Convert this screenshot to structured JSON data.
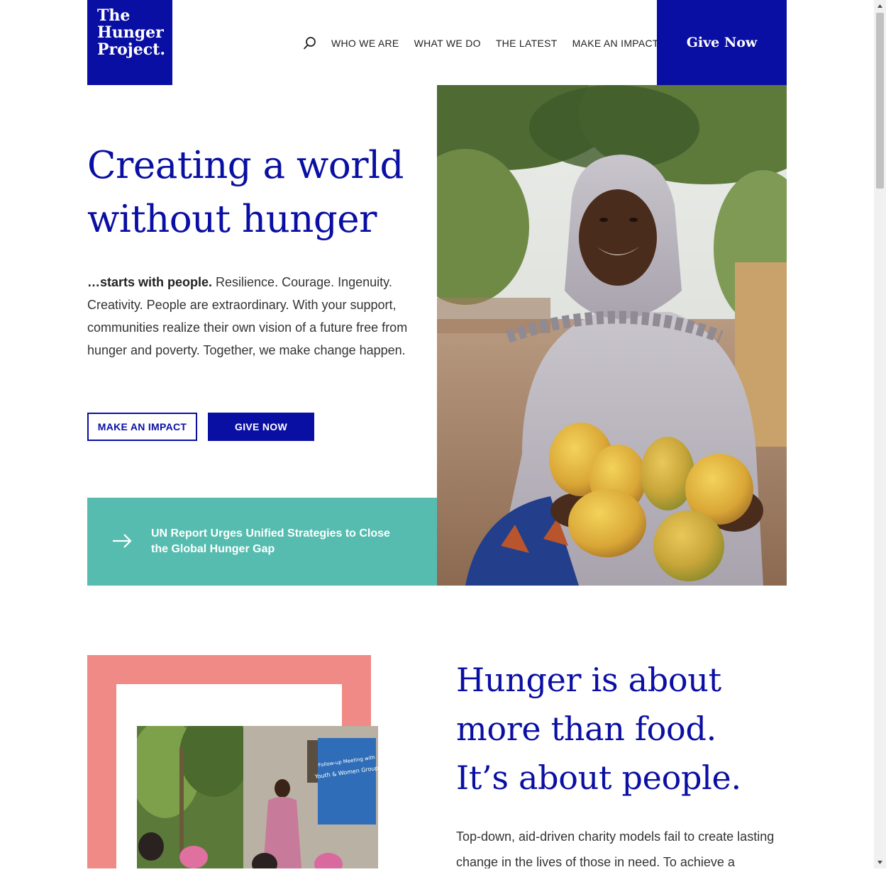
{
  "header": {
    "logo_lines": [
      "The",
      "Hunger",
      "Project."
    ],
    "nav": [
      "WHO WE ARE",
      "WHAT WE DO",
      "THE LATEST",
      "MAKE AN IMPACT"
    ],
    "give_now": "Give Now"
  },
  "hero": {
    "title": "Creating a world without hunger",
    "intro_bold": "…starts with people.",
    "intro_text": " Resilience. Courage. Ingenuity. Creativity. People are extraordinary. With your support, communities realize their own vision of a future free from hunger and poverty. Together, we make change happen.",
    "btn_make_impact": "MAKE AN IMPACT",
    "btn_give_now": "GIVE NOW",
    "news_link": "UN Report Urges Unified Strategies to Close the Global Hunger Gap"
  },
  "photo_banner": {
    "line1": "Follow-up Meeting with",
    "line2": "Youth & Women Group"
  },
  "about": {
    "title_lines": [
      "Hunger is about",
      "more than food.",
      "It’s about people."
    ],
    "text": "Top-down, aid-driven charity models fail to create lasting change in the lives of those in need. To achieve a"
  },
  "colors": {
    "brand_blue": "#0a0fa3",
    "teal": "#56bcaf",
    "pink": "#f08a86"
  },
  "icons": {
    "search": "search-icon",
    "news_arrow": "arrow-right-icon"
  }
}
